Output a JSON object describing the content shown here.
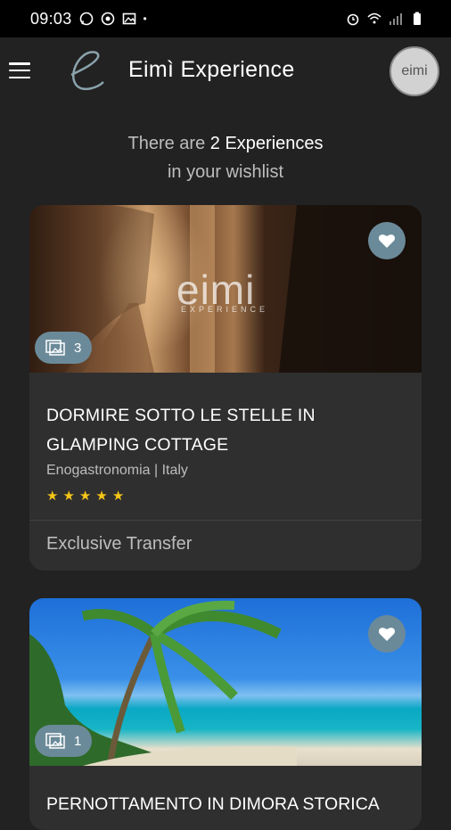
{
  "status": {
    "time": "09:03",
    "icons_left": [
      "whatsapp-icon",
      "sync-icon",
      "image-icon",
      "dot"
    ],
    "icons_right": [
      "alarm-icon",
      "wifi-icon",
      "signal-icon",
      "battery-icon"
    ]
  },
  "appbar": {
    "title": "Eimì Experience",
    "avatar_text": "eimi"
  },
  "summary": {
    "prefix": "There are",
    "count": "2 Experiences",
    "suffix": "in your wishlist"
  },
  "cards": [
    {
      "image_watermark": "eimi",
      "image_watermark_sub": "EXPERIENCE",
      "photos": "3",
      "title": "DORMIRE SOTTO LE STELLE IN GLAMPING COTTAGE",
      "subtitle": "Enogastronomia | Italy",
      "rating": 5,
      "footer": "Exclusive Transfer"
    },
    {
      "photos": "1",
      "title": "PERNOTTAMENTO IN DIMORA STORICA"
    }
  ],
  "colors": {
    "background": "#222222",
    "card": "#2f2f2f",
    "badge": "#6b8a99",
    "star": "#f5c518"
  }
}
